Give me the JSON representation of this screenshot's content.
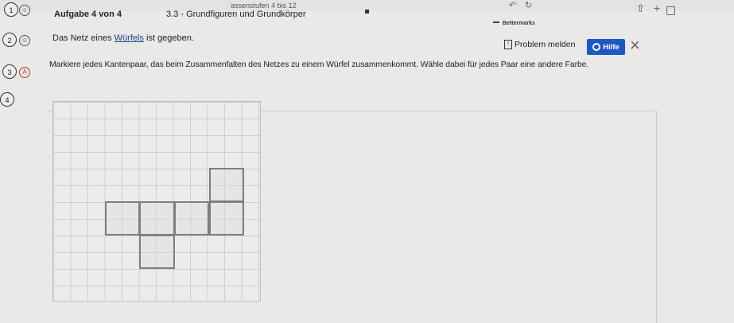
{
  "browser": {
    "url": "assenstufen 4 bis 12",
    "bookmark": "Bettermarks"
  },
  "steps": [
    {
      "number": "1",
      "badge": ""
    },
    {
      "number": "2",
      "badge": ""
    },
    {
      "number": "3",
      "badge": "A"
    },
    {
      "number": "4",
      "badge": ""
    }
  ],
  "task": {
    "title": "Aufgabe 4 von 4",
    "topic": "3.3 - Grundfiguren und Grundkörper",
    "intro_before": "Das Netz eines ",
    "intro_link": "Würfels",
    "intro_after": " ist gegeben.",
    "instruction": "Markiere jedes Kantenpaar, das beim Zusammenfalten des Netzes zu einem Würfel zusammenkommt. Wähle dabei für jedes Paar eine andere Farbe."
  },
  "actions": {
    "report": "Problem melden",
    "help": "Hilfe"
  },
  "cube_net": {
    "grid_columns": 12,
    "grid_rows": 12,
    "faces": [
      {
        "col": 9,
        "row": 4
      },
      {
        "col": 3,
        "row": 6
      },
      {
        "col": 5,
        "row": 6
      },
      {
        "col": 7,
        "row": 6
      },
      {
        "col": 9,
        "row": 6
      },
      {
        "col": 5,
        "row": 8
      }
    ]
  },
  "colors": {
    "accent": "#1f57c6",
    "face_border": "#7f7f7f"
  }
}
